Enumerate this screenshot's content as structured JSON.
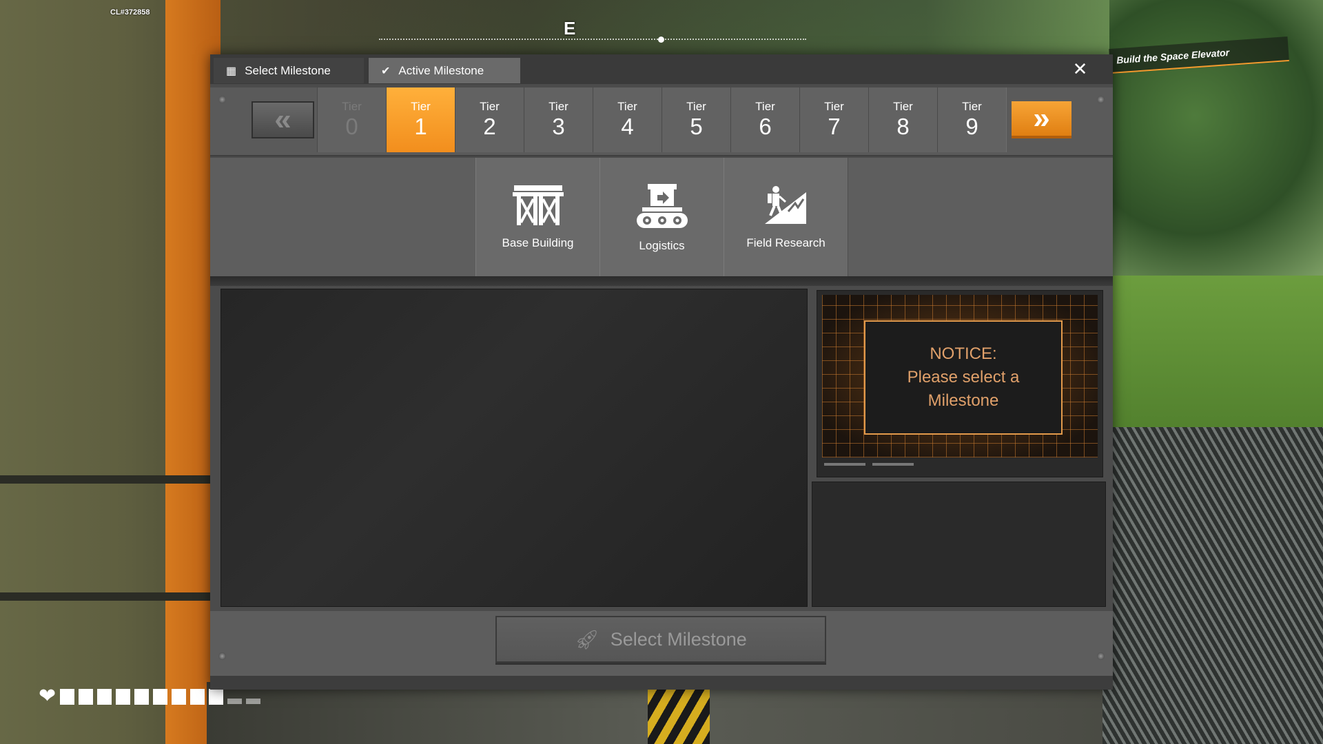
{
  "hud": {
    "build_label": "CL#372858",
    "compass_letter": "E",
    "objective": "Build the Space Elevator"
  },
  "tabs": {
    "select": {
      "label": "Select Milestone",
      "icon": "grid-icon"
    },
    "active": {
      "label": "Active Milestone",
      "icon": "checkmark-icon"
    }
  },
  "close_label": "✕",
  "tier_nav": {
    "prev_icon": "double-chevron-left-icon",
    "next_icon": "double-chevron-right-icon"
  },
  "tiers": [
    {
      "label": "Tier",
      "number": "0",
      "state": "locked"
    },
    {
      "label": "Tier",
      "number": "1",
      "state": "selected"
    },
    {
      "label": "Tier",
      "number": "2",
      "state": "normal"
    },
    {
      "label": "Tier",
      "number": "3",
      "state": "normal"
    },
    {
      "label": "Tier",
      "number": "4",
      "state": "normal"
    },
    {
      "label": "Tier",
      "number": "5",
      "state": "normal"
    },
    {
      "label": "Tier",
      "number": "6",
      "state": "normal"
    },
    {
      "label": "Tier",
      "number": "7",
      "state": "normal"
    },
    {
      "label": "Tier",
      "number": "8",
      "state": "normal"
    },
    {
      "label": "Tier",
      "number": "9",
      "state": "normal"
    }
  ],
  "milestones": [
    {
      "label": "Base Building",
      "icon": "scaffold-icon"
    },
    {
      "label": "Logistics",
      "icon": "conveyor-icon"
    },
    {
      "label": "Field Research",
      "icon": "hiker-icon"
    }
  ],
  "notice": {
    "line1": "NOTICE:",
    "line2": "Please select a",
    "line3": "Milestone"
  },
  "select_button": {
    "label": "Select Milestone",
    "icon": "rocket-icon"
  },
  "colors": {
    "accent_orange": "#f7a436",
    "panel_bg": "#4b4b4b",
    "notice_text": "#e0a06a"
  }
}
